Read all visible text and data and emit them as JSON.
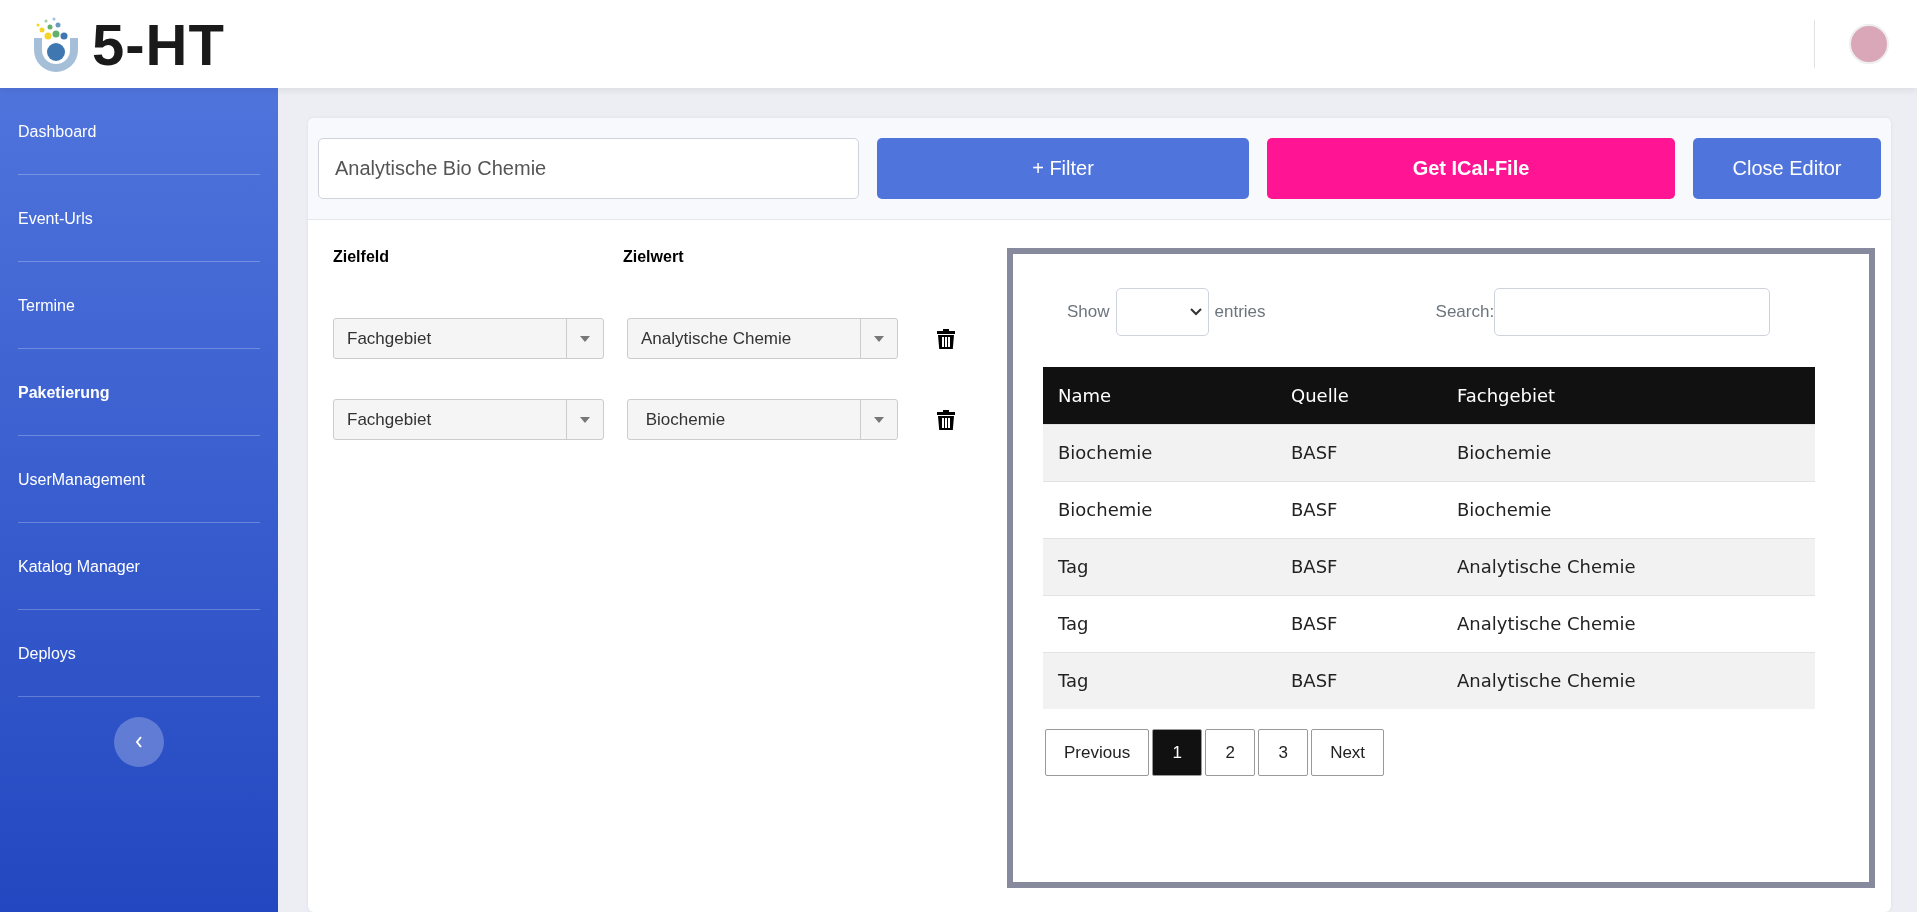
{
  "header": {
    "logo_text": "5-HT"
  },
  "sidebar": {
    "items": [
      {
        "label": "Dashboard",
        "selected": false
      },
      {
        "label": "Event-Urls",
        "selected": false
      },
      {
        "label": "Termine",
        "selected": false
      },
      {
        "label": "Paketierung",
        "selected": true
      },
      {
        "label": "UserManagement",
        "selected": false
      },
      {
        "label": "Katalog Manager",
        "selected": false
      },
      {
        "label": "Deploys",
        "selected": false
      }
    ]
  },
  "toolbar": {
    "name_value": "Analytische Bio Chemie",
    "buttons": [
      {
        "label": "+ Filter",
        "kind": "primary"
      },
      {
        "label": "Get ICal-File",
        "kind": "accent"
      },
      {
        "label": "Close Editor",
        "kind": "primary"
      }
    ]
  },
  "filters": {
    "columns": [
      "Zielfeld",
      "Zielwert"
    ],
    "rows": [
      {
        "field": "Fachgebiet",
        "value": "Analytische Chemie"
      },
      {
        "field": "Fachgebiet",
        "value": " Biochemie"
      }
    ]
  },
  "preview": {
    "show_label": "Show",
    "entries_label": "entries",
    "search_label": "Search:",
    "table": {
      "columns": [
        "Name",
        "Quelle",
        "Fachgebiet"
      ],
      "rows": [
        [
          "Biochemie",
          "BASF",
          "Biochemie"
        ],
        [
          "Biochemie",
          "BASF",
          "Biochemie"
        ],
        [
          "Tag",
          "BASF",
          "Analytische Chemie"
        ],
        [
          "Tag",
          "BASF",
          "Analytische Chemie"
        ],
        [
          "Tag",
          "BASF",
          "Analytische Chemie"
        ]
      ]
    },
    "pagination": [
      {
        "label": "Previous",
        "selected": false
      },
      {
        "label": "1",
        "selected": true
      },
      {
        "label": "2",
        "selected": false
      },
      {
        "label": "3",
        "selected": false
      },
      {
        "label": "Next",
        "selected": false
      }
    ]
  }
}
